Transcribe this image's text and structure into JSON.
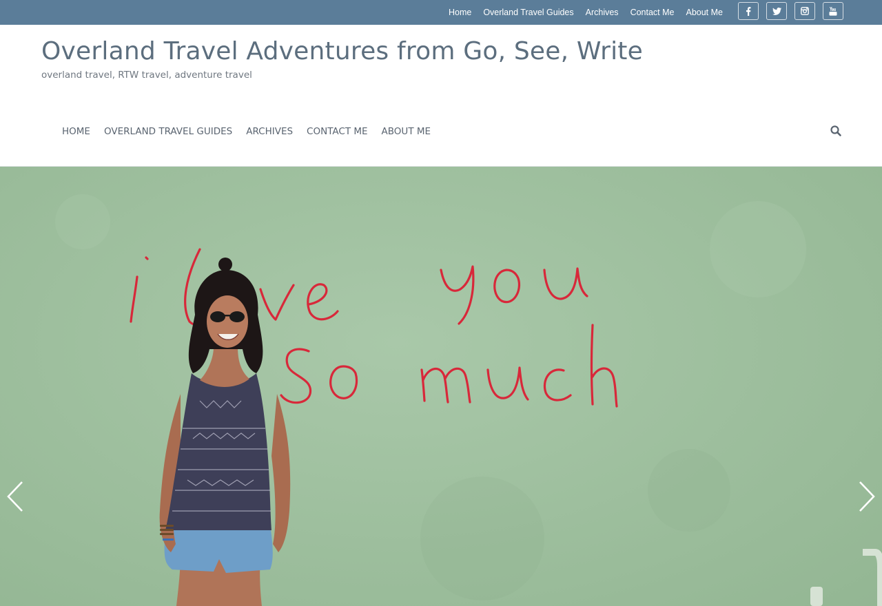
{
  "top_nav": {
    "items": [
      "Home",
      "Overland Travel Guides",
      "Archives",
      "Contact Me",
      "About Me"
    ]
  },
  "social": {
    "icons": [
      "facebook-icon",
      "twitter-icon",
      "instagram-icon",
      "youtube-icon"
    ]
  },
  "header": {
    "title": "Overland Travel Adventures from Go, See, Write",
    "tagline": "overland travel, RTW travel, adventure travel"
  },
  "main_nav": {
    "items": [
      "HOME",
      "OVERLAND TRAVEL GUIDES",
      "ARCHIVES",
      "CONTACT ME",
      "ABOUT ME"
    ],
    "search_icon": "search-icon"
  },
  "hero": {
    "wall_text_line1": "i love you",
    "wall_text_line2": "So much",
    "prev_icon": "chevron-left-icon",
    "next_icon": "chevron-right-icon"
  },
  "colors": {
    "topbar": "#5b7d99",
    "wall": "#9fc09f",
    "graffiti": "#d8283a"
  }
}
